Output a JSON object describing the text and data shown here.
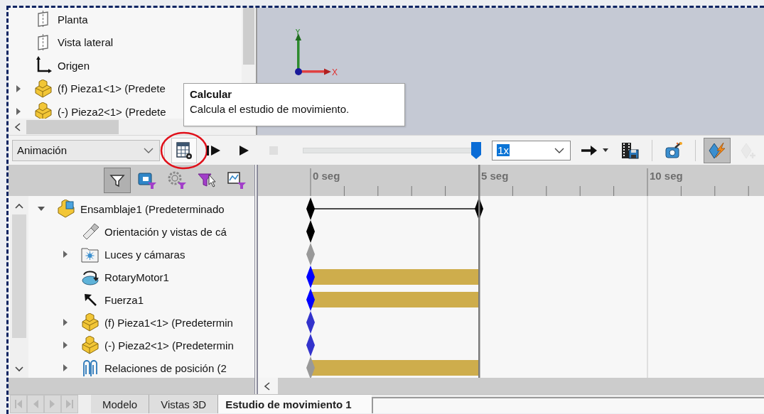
{
  "feature_tree": {
    "items": [
      {
        "label": "Planta",
        "kind": "plane"
      },
      {
        "label": "Vista lateral",
        "kind": "plane"
      },
      {
        "label": "Origen",
        "kind": "origin"
      },
      {
        "label": "(f) Pieza1<1> (Predete",
        "kind": "part",
        "expanded": false
      },
      {
        "label": "(-) Pieza2<1> (Predete",
        "kind": "part",
        "expanded": false
      }
    ]
  },
  "viewport": {
    "axis_labels": [
      "Y",
      "X"
    ]
  },
  "tooltip": {
    "title": "Calcular",
    "text": "Calcula el estudio de movimiento."
  },
  "toolbar": {
    "study_type": "Animación",
    "tools": [
      {
        "kind": "calculate",
        "highlighted": true,
        "pressed": false,
        "disabled": false
      },
      {
        "kind": "play-from-start",
        "highlighted": false,
        "pressed": false,
        "disabled": false
      },
      {
        "kind": "play",
        "highlighted": false,
        "pressed": false,
        "disabled": false
      },
      {
        "kind": "stop",
        "highlighted": false,
        "pressed": false,
        "disabled": true
      }
    ],
    "slider": {
      "level": 1
    },
    "speed": "1x",
    "tools_right": [
      {
        "kind": "playback-mode",
        "pressed": false,
        "disabled": false
      },
      {
        "kind": "save-animation",
        "pressed": false,
        "disabled": false
      },
      {
        "kind": "animation-wizard",
        "pressed": false,
        "disabled": false
      },
      {
        "kind": "autokey",
        "pressed": true,
        "disabled": false
      },
      {
        "kind": "add-key",
        "pressed": false,
        "disabled": true
      }
    ]
  },
  "filter_bar": {
    "buttons": [
      {
        "kind": "filter",
        "pressed": true
      },
      {
        "kind": "camera-filter",
        "pressed": false
      },
      {
        "kind": "gear-filter",
        "pressed": false
      },
      {
        "kind": "select-filter",
        "pressed": false
      },
      {
        "kind": "chart-filter",
        "pressed": false
      }
    ]
  },
  "motion_tree": {
    "items": [
      {
        "label": "Ensamblaje1 (Predeterminado",
        "kind": "assembly",
        "expanded": true,
        "children": [
          {
            "label": "Orientación y vistas de cá",
            "kind": "camera"
          },
          {
            "label": "Luces y cámaras",
            "kind": "lights",
            "expanded": false
          },
          {
            "label": "RotaryMotor1",
            "kind": "motor"
          },
          {
            "label": "Fuerza1",
            "kind": "force"
          },
          {
            "label": "(f) Pieza1<1> (Predetermin",
            "kind": "part",
            "expanded": false
          },
          {
            "label": "(-) Pieza2<1> (Predetermin",
            "kind": "part",
            "expanded": false
          },
          {
            "label": "Relaciones de posición (2",
            "kind": "mates",
            "expanded": false
          }
        ]
      }
    ]
  },
  "timeline": {
    "ruler": [
      "0 seg",
      "5 seg",
      "10 seg"
    ],
    "tracks": [
      {
        "kind": "span",
        "color": "#000000"
      },
      {
        "kind": "key",
        "color": "#000000"
      },
      {
        "kind": "key",
        "color": "#999999"
      },
      {
        "kind": "bar",
        "color": "#0000ff"
      },
      {
        "kind": "bar",
        "color": "#0000ff"
      },
      {
        "kind": "key",
        "color": "#3333cc"
      },
      {
        "kind": "key",
        "color": "#3333cc"
      },
      {
        "kind": "bar",
        "color": "#999999"
      }
    ]
  },
  "tab_nav": [
    {
      "kind": "first",
      "disabled": true
    },
    {
      "kind": "previous",
      "disabled": true
    },
    {
      "kind": "next",
      "disabled": true
    },
    {
      "kind": "last",
      "disabled": true
    }
  ],
  "tabs": [
    {
      "label": "Modelo",
      "selected": false
    },
    {
      "label": "Vistas 3D",
      "selected": false
    },
    {
      "label": "Estudio de movimiento 1",
      "selected": true
    }
  ]
}
